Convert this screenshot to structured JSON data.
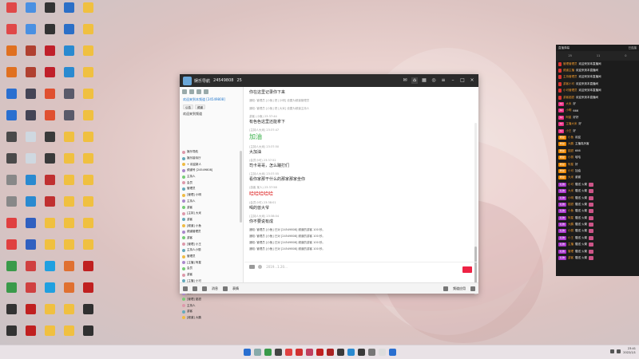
{
  "desktop": {
    "icons": [
      {
        "label": "",
        "color": "#e04848"
      },
      {
        "label": "",
        "color": "#4a90e2"
      },
      {
        "label": "",
        "color": "#333"
      },
      {
        "label": "",
        "color": "#2b6fc7"
      },
      {
        "label": "",
        "color": "#f0c040"
      },
      {
        "label": "",
        "color": "#e07020"
      },
      {
        "label": "",
        "color": "#b04030"
      },
      {
        "label": "",
        "color": "#c0202a"
      },
      {
        "label": "",
        "color": "#2a8ad0"
      },
      {
        "label": "",
        "color": "#f0c040"
      },
      {
        "label": "",
        "color": "#2a6fd0"
      },
      {
        "label": "",
        "color": "#445"
      },
      {
        "label": "",
        "color": "#e05030"
      },
      {
        "label": "",
        "color": "#5a5a6a"
      },
      {
        "label": "",
        "color": "#f0c040"
      },
      {
        "label": "",
        "color": "#4a4a4a"
      },
      {
        "label": "",
        "color": "#cfd8e0"
      },
      {
        "label": "",
        "color": "#3a3a3a"
      },
      {
        "label": "",
        "color": "#f0c040"
      },
      {
        "label": "",
        "color": "#f0c040"
      },
      {
        "label": "",
        "color": "#888"
      },
      {
        "label": "",
        "color": "#2a8ad0"
      },
      {
        "label": "",
        "color": "#c03030"
      },
      {
        "label": "",
        "color": "#f0c040"
      },
      {
        "label": "",
        "color": "#f0c040"
      },
      {
        "label": "",
        "color": "#e04040"
      },
      {
        "label": "",
        "color": "#3060c0"
      },
      {
        "label": "",
        "color": "#f0c040"
      },
      {
        "label": "",
        "color": "#f0c040"
      },
      {
        "label": "",
        "color": "#f0c040"
      },
      {
        "label": "",
        "color": "#3a9a4a"
      },
      {
        "label": "",
        "color": "#d04040"
      },
      {
        "label": "",
        "color": "#20a0e0"
      },
      {
        "label": "",
        "color": "#e07030"
      },
      {
        "label": "",
        "color": "#c02020"
      },
      {
        "label": "",
        "color": "#333"
      },
      {
        "label": "",
        "color": "#c02020"
      },
      {
        "label": "",
        "color": "#f0c040"
      },
      {
        "label": "",
        "color": "#f0c040"
      },
      {
        "label": "",
        "color": "#303030"
      }
    ]
  },
  "chat": {
    "title": "娱乐导航",
    "id": "24549808",
    "online": "25",
    "left": {
      "notice": "欢迎来到频道",
      "lines": [
        "欢迎来到本频道 [24549808]",
        "会员"
      ],
      "buttons": [
        "公告",
        "频道"
      ],
      "members": [
        "娱乐导航",
        "娱乐接待厅",
        "+ 欢迎新人",
        "频道号 [24549808]",
        "主持人",
        "会员",
        "管理员",
        "[管理] 小明",
        "主持人",
        "游客",
        "[主持] 大米",
        "游客",
        "[频道] 小鱼",
        "频道管理员",
        "游客",
        "[管理] 小王",
        "主持人小丽",
        "管理员",
        "[主播] 阿星",
        "会员",
        "游客",
        "[主播] 小可",
        "娱乐一哥",
        "会员",
        "[管理] 甜甜",
        "主持人",
        "游客",
        "[频道] 大鹏"
      ]
    },
    "messages": [
      {
        "meta": "",
        "body": "你在这里记录你下来"
      },
      {
        "meta": "通知: 管理员 [小鱼] 把 [小明] 设置为频道管理员",
        "body": ""
      },
      {
        "meta": "通知: 管理员 [小鱼] 把 [大米] 设置为频道主持人",
        "body": ""
      },
      {
        "meta": "游客 (小鱼) 23:37:44",
        "body": "有色色这里还能拿下"
      },
      {
        "meta": "(主持人大米) 23:37:47",
        "body": "加油",
        "big": true
      },
      {
        "meta": "(主持人大米) 23:37:50",
        "body": "大加油"
      },
      {
        "meta": "(会员小可) 23:37:52",
        "body": "司卡哥哥，怎么踹打们"
      },
      {
        "meta": "(主持人大米) 23:37:55",
        "body": "看你家那干什么的那家那家坐你"
      },
      {
        "meta": "(游客 某人) 23:37:58",
        "body": "哈哈哈哈哈",
        "red": true
      },
      {
        "meta": "(会员小可) 23:38:01",
        "body": "喝的兽大爷"
      },
      {
        "meta": "(主持人大米) 23:38:04",
        "body": "你不要说有成"
      }
    ],
    "system": [
      "通知: 管理员 [小鱼] 已对 [24549808] 频道的游客 100 秒。",
      "通知: 管理员 [小鱼] 已对 [24549808] 频道的游客 100 秒。",
      "通知: 管理员 [小鱼] 已对 [24549808] 频道的游客 100 秒。",
      "通知: 管理员 [小鱼] 已对 [24549808] 频道的游客 100 秒。"
    ],
    "input_placeholder": "2019...1.20...",
    "bottom": {
      "a": "消息",
      "b": "表情",
      "c": "语音",
      "d": "频道应用"
    }
  },
  "danmu": {
    "title": "直播弹幕",
    "close": "已连接",
    "stats": [
      "25",
      "11",
      "0"
    ],
    "items": [
      {
        "tag": "",
        "name": "管理管理员",
        "text": "欢迎来到本直播间",
        "color": "#d33"
      },
      {
        "tag": "",
        "name": "频道主播",
        "text": "欢迎来到本直播间",
        "color": "#d33"
      },
      {
        "tag": "",
        "name": "主持管理员",
        "text": "欢迎来到本直播间",
        "color": "#d33"
      },
      {
        "tag": "",
        "name": "游客小可",
        "text": "欢迎来到本直播间",
        "color": "#d33"
      },
      {
        "tag": "",
        "name": "小可管理员",
        "text": "欢迎来到本直播间",
        "color": "#d33"
      },
      {
        "tag": "",
        "name": "游客甜甜",
        "text": "欢迎来到本直播间",
        "color": "#d33"
      },
      {
        "tag": "LV",
        "name": "大米",
        "text": "好",
        "color": "#e38"
      },
      {
        "tag": "LV",
        "name": "小明",
        "text": "666",
        "color": "#e38"
      },
      {
        "tag": "LV",
        "name": "阿星",
        "text": "好好",
        "color": "#e38"
      },
      {
        "tag": "LV",
        "name": "主播大米",
        "text": "好",
        "color": "#e38"
      },
      {
        "tag": "LV",
        "name": "小王",
        "text": "好",
        "color": "#e38"
      },
      {
        "tag": "粉丝",
        "name": "小鱼",
        "text": "欢迎",
        "color": "#e80"
      },
      {
        "tag": "粉丝",
        "name": "大鹏",
        "text": "主播真厉害",
        "color": "#e80"
      },
      {
        "tag": "粉丝",
        "name": "甜甜",
        "text": "666",
        "color": "#e80"
      },
      {
        "tag": "粉丝",
        "name": "小丽",
        "text": "哈哈",
        "color": "#e80"
      },
      {
        "tag": "粉丝",
        "name": "阿星",
        "text": "好",
        "color": "#e80"
      },
      {
        "tag": "粉丝",
        "name": "小可",
        "text": "加油",
        "color": "#e80"
      },
      {
        "tag": "粉丝",
        "name": "大米",
        "text": "谢谢",
        "color": "#e80"
      },
      {
        "tag": "礼物",
        "name": "小可",
        "text": "赠送 火箭",
        "color": "#a3c"
      },
      {
        "tag": "礼物",
        "name": "大米",
        "text": "赠送 火箭",
        "color": "#a3c"
      },
      {
        "tag": "礼物",
        "name": "小明",
        "text": "赠送 火箭",
        "color": "#a3c"
      },
      {
        "tag": "礼物",
        "name": "甜甜",
        "text": "赠送 火箭",
        "color": "#a3c"
      },
      {
        "tag": "礼物",
        "name": "小鱼",
        "text": "赠送 火箭",
        "color": "#a3c"
      },
      {
        "tag": "礼物",
        "name": "阿星",
        "text": "赠送 火箭",
        "color": "#a3c"
      },
      {
        "tag": "礼物",
        "name": "大鹏",
        "text": "赠送 火箭",
        "color": "#a3c"
      },
      {
        "tag": "礼物",
        "name": "小丽",
        "text": "赠送 火箭",
        "color": "#a3c"
      },
      {
        "tag": "礼物",
        "name": "小王",
        "text": "赠送 火箭",
        "color": "#a3c"
      },
      {
        "tag": "礼物",
        "name": "主播",
        "text": "赠送 火箭",
        "color": "#a3c"
      },
      {
        "tag": "礼物",
        "name": "管理",
        "text": "赠送 火箭",
        "color": "#a3c"
      },
      {
        "tag": "礼物",
        "name": "游客",
        "text": "赠送 火箭",
        "color": "#a3c"
      }
    ]
  },
  "taskbar": {
    "apps": [
      "#2a6fd0",
      "#8aa",
      "#3a9a4a",
      "#444",
      "#e04040",
      "#d03030",
      "#c04060",
      "#c02020",
      "#aa2222",
      "#3a3a3a",
      "#2a8ad0",
      "#3a3a3a",
      "#777",
      "#dddddd",
      "#2a6fd0"
    ],
    "time": "23:41",
    "date": "2022/1/1"
  }
}
